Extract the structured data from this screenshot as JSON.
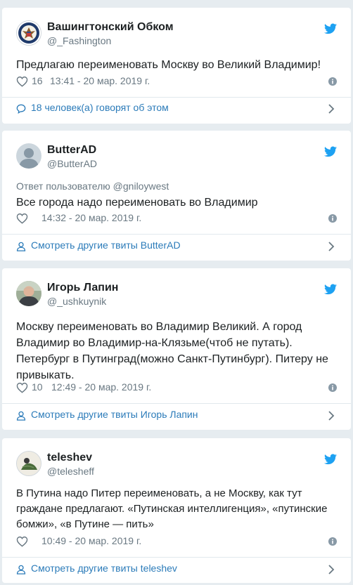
{
  "tweets": [
    {
      "name": "Вашингтонский Обком",
      "handle": "@_Fashington",
      "reply_to": "",
      "text": "Предлагаю переименовать Москву во Великий Владимир!",
      "likes": "16",
      "time": "13:41 - 20 мар. 2019 г.",
      "footer": "18 человек(а) говорят об этом",
      "footer_icon": "comment-icon",
      "avatar": "seal-icon"
    },
    {
      "name": "ButterAD",
      "handle": "@ButterAD",
      "reply_to": "Ответ пользователю @gniloywest",
      "text": "Все города надо переименовать во Владимир",
      "likes": "",
      "time": "14:32 - 20 мар. 2019 г.",
      "footer": "Смотреть другие твиты ButterAD",
      "footer_icon": "person-icon",
      "avatar": "default-person-icon"
    },
    {
      "name": "Игорь Лапин",
      "handle": "@_ushkuynik",
      "reply_to": "",
      "text": "Москву переименовать во Владимир Великий. А город Владимир во Владимир-на-Клязьме(чтоб не путать). Петербург в Путинград(можно Санкт-Путинбург). Питеру не привыкать.",
      "likes": "10",
      "time": "12:49 - 20 мар. 2019 г.",
      "footer": "Смотреть другие твиты Игорь Лапин",
      "footer_icon": "person-icon",
      "avatar": "photo-avatar"
    },
    {
      "name": "teleshev",
      "handle": "@telesheff",
      "reply_to": "",
      "text": "В Путина надо Питер переименовать, а не Москву, как тут граждане предлагают. «Путинская интеллигенция», «путинские бомжи», «в Путине — пить»",
      "likes": "",
      "time": "10:49 - 20 мар. 2019 г.",
      "footer": "Смотреть другие твиты teleshev",
      "footer_icon": "person-icon",
      "avatar": "illustration-avatar"
    }
  ],
  "colors": {
    "background": "#e6ecf0",
    "twitter_blue": "#1da1f2",
    "link": "#2b7bb9",
    "muted": "#697882"
  }
}
